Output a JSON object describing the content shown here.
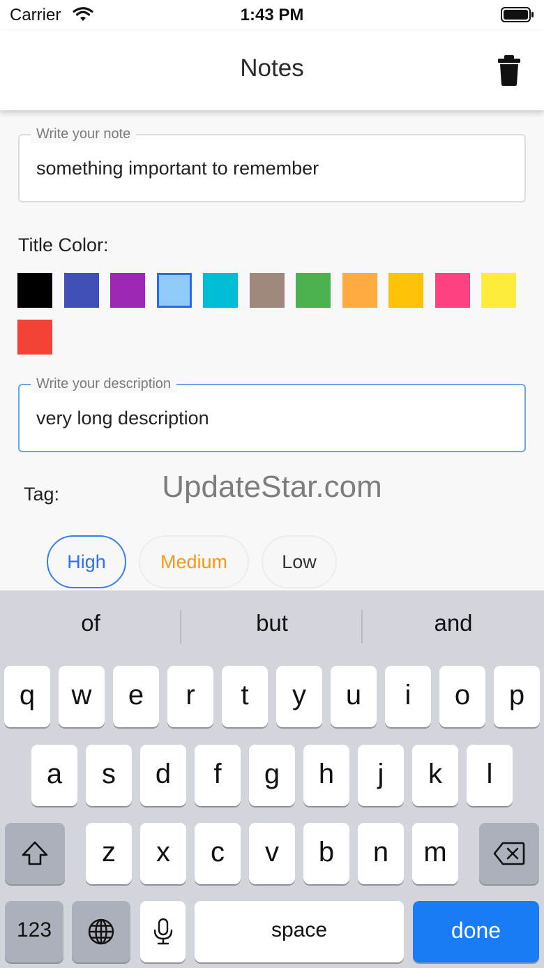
{
  "status_bar": {
    "carrier": "Carrier",
    "time": "1:43 PM"
  },
  "app_bar": {
    "title": "Notes",
    "action_icon": "trash-icon"
  },
  "note_field": {
    "label": "Write your note",
    "value": "something important to remember"
  },
  "title_color": {
    "label": "Title Color:",
    "swatches": [
      {
        "name": "black",
        "color": "#000000",
        "selected": false
      },
      {
        "name": "indigo",
        "color": "#3f51b5",
        "selected": false
      },
      {
        "name": "purple",
        "color": "#9c27b0",
        "selected": false
      },
      {
        "name": "light-blue",
        "color": "#90caf9",
        "selected": true
      },
      {
        "name": "cyan",
        "color": "#00bcd4",
        "selected": false
      },
      {
        "name": "brown",
        "color": "#a1887f",
        "selected": false
      },
      {
        "name": "green",
        "color": "#4caf50",
        "selected": false
      },
      {
        "name": "light-orange",
        "color": "#ffab40",
        "selected": false
      },
      {
        "name": "amber",
        "color": "#ffc107",
        "selected": false
      },
      {
        "name": "pink",
        "color": "#ff4081",
        "selected": false
      },
      {
        "name": "yellow",
        "color": "#ffeb3b",
        "selected": false
      },
      {
        "name": "red",
        "color": "#f44336",
        "selected": false
      }
    ]
  },
  "description_field": {
    "label": "Write your description",
    "value": "very long description"
  },
  "tag": {
    "label": "Tag:",
    "options": [
      {
        "label": "High",
        "selected": true,
        "color": "#2f6ff0"
      },
      {
        "label": "Medium",
        "selected": false,
        "color": "#f0981d"
      },
      {
        "label": "Low",
        "selected": false,
        "color": "#333333"
      }
    ]
  },
  "watermark": "UpdateStar.com",
  "keyboard": {
    "suggestions": [
      "of",
      "but",
      "and"
    ],
    "row1": [
      "q",
      "w",
      "e",
      "r",
      "t",
      "y",
      "u",
      "i",
      "o",
      "p"
    ],
    "row2": [
      "a",
      "s",
      "d",
      "f",
      "g",
      "h",
      "j",
      "k",
      "l"
    ],
    "row3": [
      "z",
      "x",
      "c",
      "v",
      "b",
      "n",
      "m"
    ],
    "numbers_key": "123",
    "space_key": "space",
    "return_key": "done",
    "icons": {
      "shift": "shift-icon",
      "backspace": "backspace-icon",
      "globe": "globe-icon",
      "mic": "microphone-icon"
    }
  },
  "colors": {
    "accent": "#1a7cf5",
    "focused_border": "#6aa4e8",
    "keyboard_bg": "#d2d5dc"
  }
}
